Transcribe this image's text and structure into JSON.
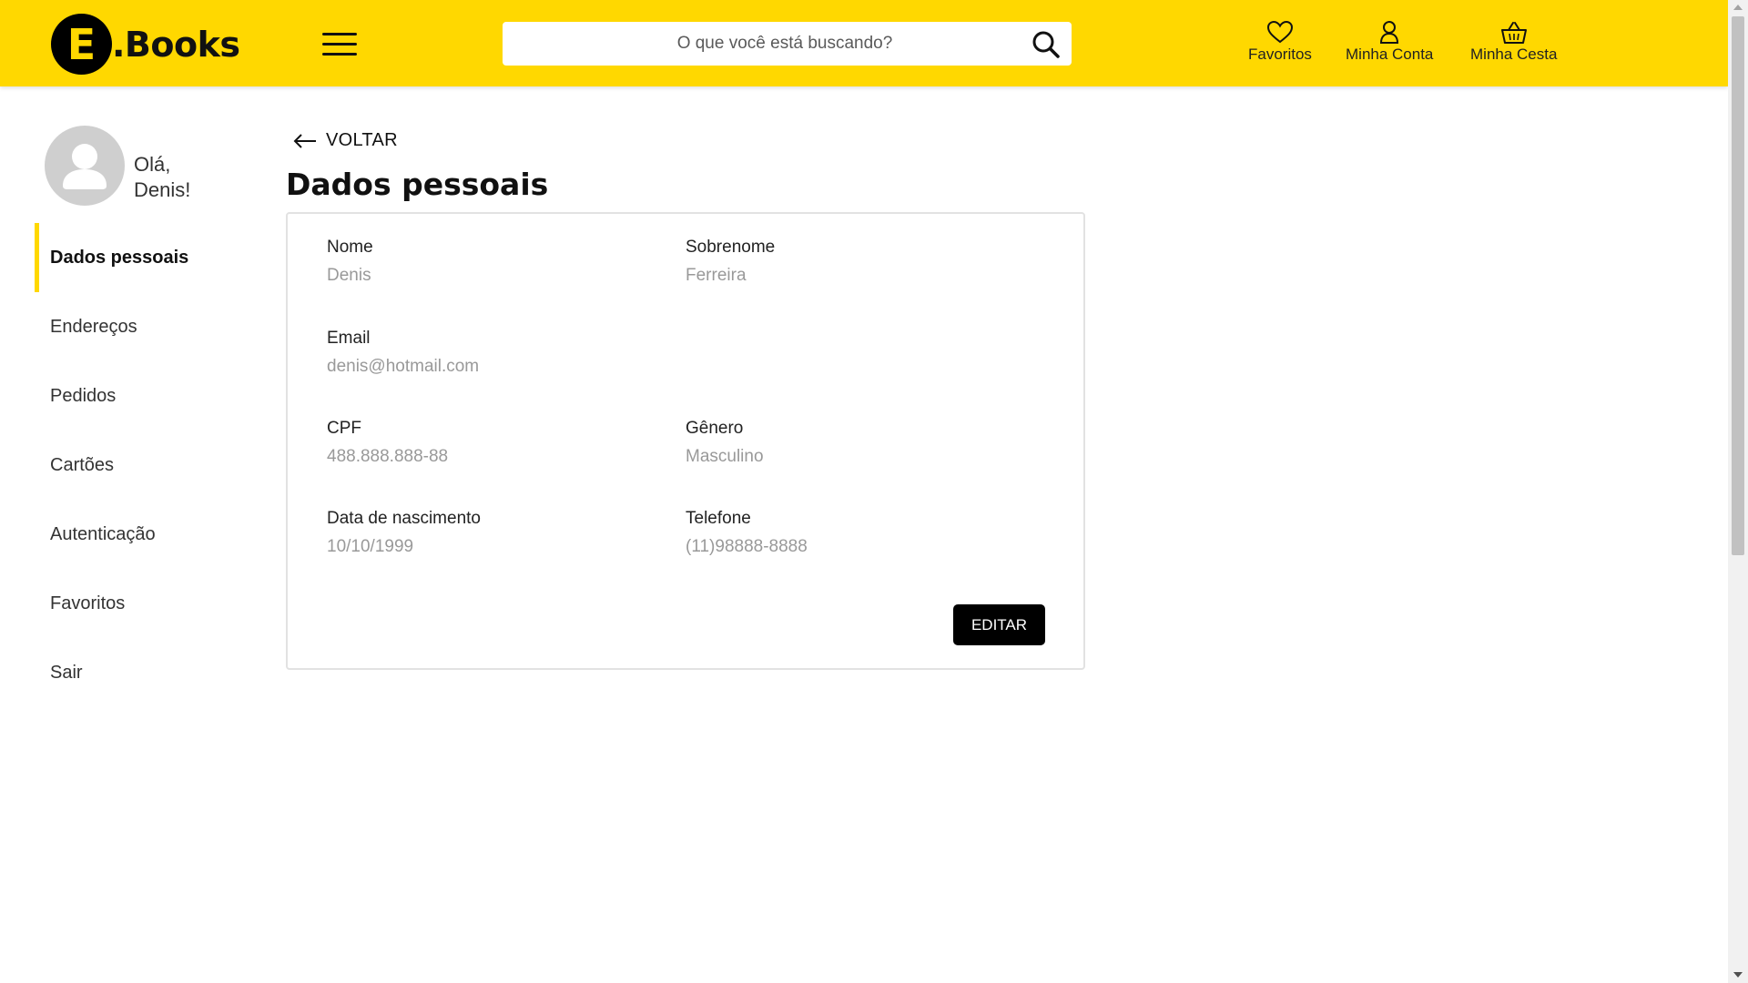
{
  "header": {
    "logo_letter": "E",
    "logo_text": ".Books",
    "search_placeholder": "O que você está buscando?",
    "nav": [
      {
        "label": "Favoritos",
        "icon": "heart-icon"
      },
      {
        "label": "Minha Conta",
        "icon": "user-icon"
      },
      {
        "label": "Minha Cesta",
        "icon": "basket-icon"
      }
    ]
  },
  "sidebar": {
    "greeting_line1": "Olá,",
    "greeting_line2": "Denis!",
    "items": [
      {
        "label": "Dados pessoais",
        "active": true
      },
      {
        "label": "Endereços"
      },
      {
        "label": "Pedidos"
      },
      {
        "label": "Cartões"
      },
      {
        "label": "Autenticação"
      },
      {
        "label": "Favoritos"
      },
      {
        "label": "Sair"
      }
    ]
  },
  "main": {
    "back_label": "VOLTAR",
    "title": "Dados pessoais",
    "fields": {
      "nome": {
        "label": "Nome",
        "value": "Denis"
      },
      "sobrenome": {
        "label": "Sobrenome",
        "value": "Ferreira"
      },
      "email": {
        "label": "Email",
        "value": "denis@hotmail.com"
      },
      "cpf": {
        "label": "CPF",
        "value": "488.888.888-88"
      },
      "genero": {
        "label": "Gênero",
        "value": "Masculino"
      },
      "nascimento": {
        "label": "Data de nascimento",
        "value": "10/10/1999"
      },
      "telefone": {
        "label": "Telefone",
        "value": "(11)98888-8888"
      }
    },
    "edit_label": "EDITAR"
  },
  "colors": {
    "brand_yellow": "#FFD800",
    "text_dark": "#111111",
    "value_gray": "#999999"
  }
}
